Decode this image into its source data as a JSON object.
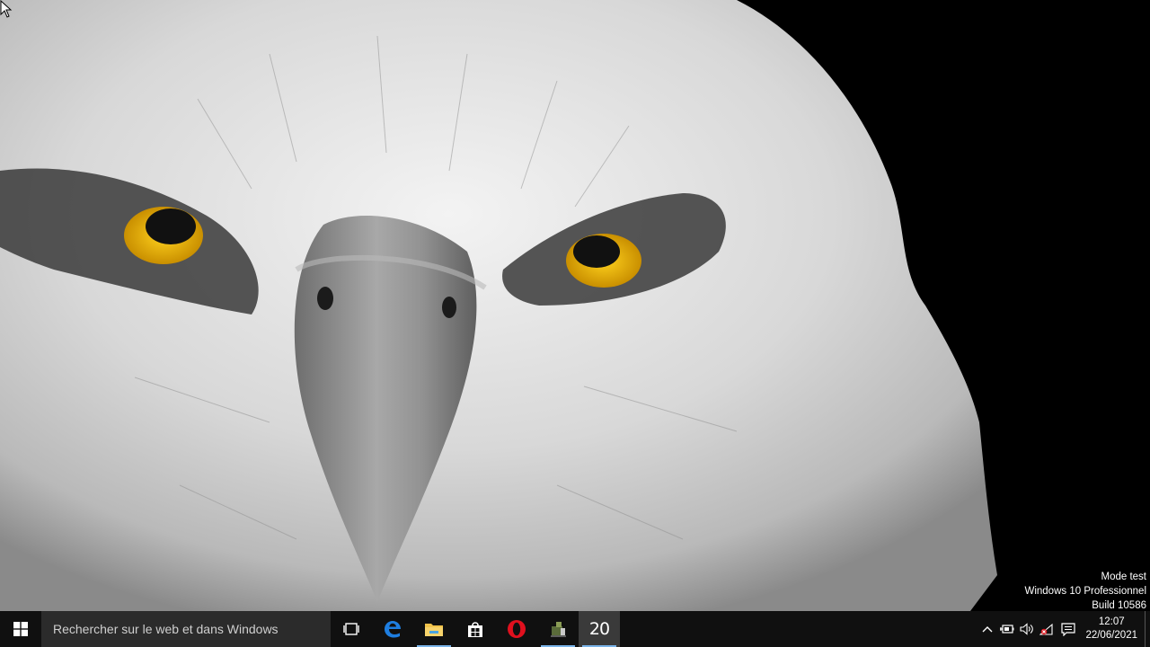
{
  "desktop": {
    "watermark": {
      "line1": "Mode test",
      "line2": "Windows 10 Professionnel",
      "line3": "Build 10586"
    }
  },
  "taskbar": {
    "search_placeholder": "Rechercher sur le web et dans Windows",
    "apps": [
      {
        "name": "task-view",
        "icon": "task-view-icon"
      },
      {
        "name": "edge",
        "icon": "edge-icon"
      },
      {
        "name": "file-explorer",
        "icon": "folder-icon"
      },
      {
        "name": "store",
        "icon": "store-icon"
      },
      {
        "name": "opera",
        "icon": "opera-icon"
      },
      {
        "name": "app-green",
        "icon": "app-icon"
      },
      {
        "name": "app-20",
        "icon": "number-20-icon",
        "label": "20"
      }
    ],
    "tray": {
      "clock_time": "12:07",
      "clock_date": "22/06/2021"
    },
    "accent_color": "#7ab3e8"
  }
}
